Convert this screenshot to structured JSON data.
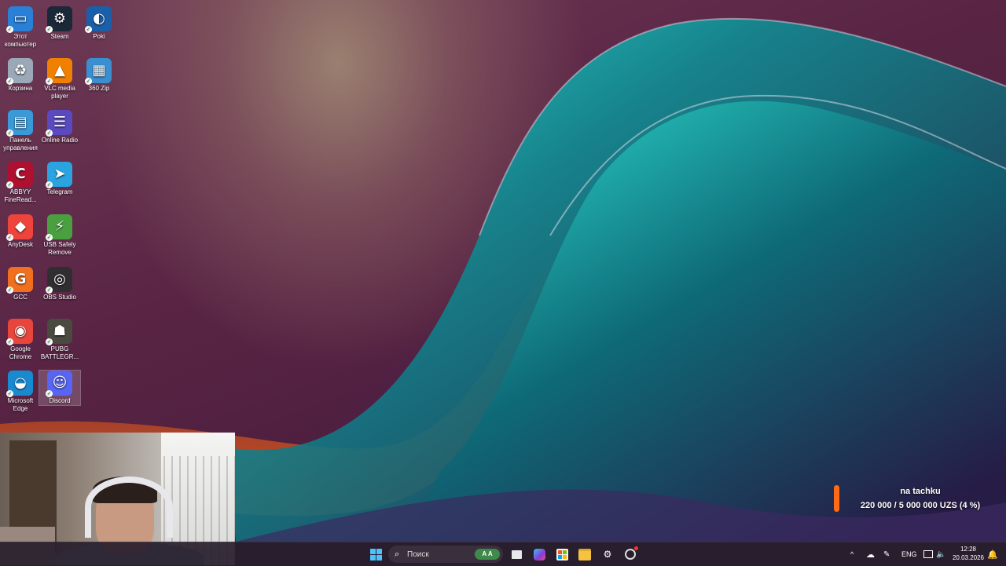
{
  "desktop": {
    "icons": [
      {
        "label": "Этот компьютер",
        "icon": "computer-icon",
        "color": "#2a7fd6"
      },
      {
        "label": "Steam",
        "icon": "steam-icon",
        "color": "#1b2838"
      },
      {
        "label": "Poki",
        "icon": "poki-icon",
        "color": "#1a5fa8"
      },
      {
        "label": "Корзина",
        "icon": "recycle-bin-icon",
        "color": "#9aa8b8"
      },
      {
        "label": "VLC media player",
        "icon": "vlc-icon",
        "color": "#f08000"
      },
      {
        "label": "360 Zip",
        "icon": "zip-icon",
        "color": "#3a8fd0"
      },
      {
        "label": "Панель управления",
        "icon": "control-panel-icon",
        "color": "#3a9ad8"
      },
      {
        "label": "Online Radio",
        "icon": "radio-icon",
        "color": "#5a4ac0"
      },
      {
        "label": "ABBYY FineRead...",
        "icon": "abbyy-icon",
        "color": "#b01030"
      },
      {
        "label": "Telegram",
        "icon": "telegram-icon",
        "color": "#2aa3e0"
      },
      {
        "label": "AnyDesk",
        "icon": "anydesk-icon",
        "color": "#ef443b"
      },
      {
        "label": "USB Safely Remove",
        "icon": "usb-icon",
        "color": "#4aa040"
      },
      {
        "label": "GCC",
        "icon": "gcc-icon",
        "color": "#f07020"
      },
      {
        "label": "OBS Studio",
        "icon": "obs-icon",
        "color": "#302e31"
      },
      {
        "label": "Google Chrome",
        "icon": "chrome-icon",
        "color": "#e8453c"
      },
      {
        "label": "PUBG BATTLEGR...",
        "icon": "pubg-icon",
        "color": "#4a4a40"
      },
      {
        "label": "Microsoft Edge",
        "icon": "edge-icon",
        "color": "#1a8ad0"
      },
      {
        "label": "Discord",
        "icon": "discord-icon",
        "color": "#5865f2"
      }
    ]
  },
  "donation": {
    "title": "na tachku",
    "amount_text": "220 000 / 5 000 000 UZS (4 %)",
    "progress": 0.04
  },
  "taskbar": {
    "search_placeholder": "Поиск",
    "search_badge": "A A",
    "apps": [
      "file-explorer-icon",
      "m365-icon",
      "store-icon",
      "folder-icon",
      "steam-icon",
      "obs-icon"
    ],
    "tray": {
      "chevron": "^",
      "language": "ENG",
      "time": "12:28",
      "date": "20.03.2026"
    }
  }
}
